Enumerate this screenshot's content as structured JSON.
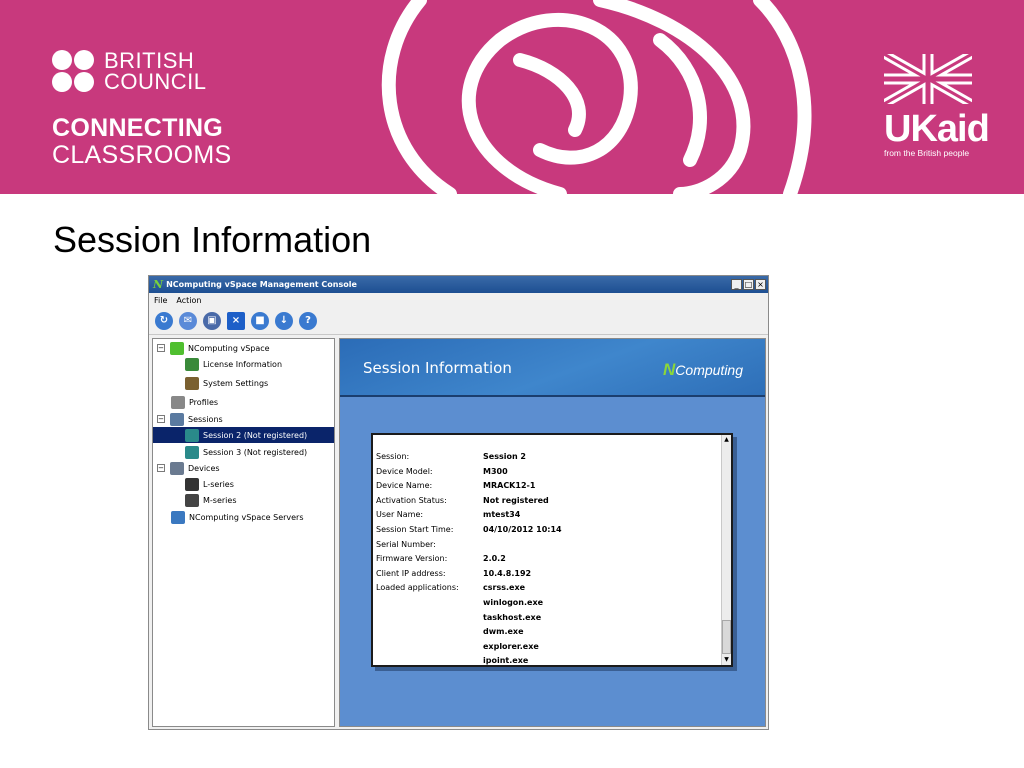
{
  "slide": {
    "brand_line1": "BRITISH",
    "brand_line2": "COUNCIL",
    "program_line1": "CONNECTING",
    "program_line2": "CLASSROOMS",
    "ukaid_word": "UKaid",
    "ukaid_tagline": "from the British people",
    "title": "Session Information",
    "banner_color": "#c8397d"
  },
  "window": {
    "title": "NComputing vSpace Management Console",
    "logo_letter": "N",
    "buttons": {
      "minimize": "_",
      "maximize": "□",
      "close": "×"
    },
    "menu": [
      "File",
      "Action"
    ],
    "toolbar": [
      {
        "icon": "refresh-icon",
        "glyph": "↻",
        "color": "#3a7ad0"
      },
      {
        "icon": "message-icon",
        "glyph": "✉",
        "color": "#5a8ad8"
      },
      {
        "icon": "monitor-icon",
        "glyph": "▣",
        "color": "#4a6aa8"
      },
      {
        "icon": "disconnect-icon",
        "glyph": "×",
        "color": "#1d5fc8"
      },
      {
        "icon": "stop-icon",
        "glyph": "■",
        "color": "#3a7ad0"
      },
      {
        "icon": "download-icon",
        "glyph": "↓",
        "color": "#3a7ad0"
      },
      {
        "icon": "help-icon",
        "glyph": "?",
        "color": "#3a7ad0"
      }
    ]
  },
  "tree": {
    "items": [
      {
        "label": "NComputing vSpace",
        "icon": "ncomputing-logo-icon",
        "expander": "−"
      },
      {
        "label": "License Information",
        "icon": "license-icon"
      },
      {
        "label": "System Settings",
        "icon": "settings-icon"
      },
      {
        "label": "Profiles",
        "icon": "profiles-icon"
      },
      {
        "label": "Sessions",
        "icon": "sessions-icon",
        "expander": "−"
      },
      {
        "label": "Session 2 (Not registered)",
        "icon": "session-monitor-icon",
        "selected": true
      },
      {
        "label": "Session 3 (Not registered)",
        "icon": "session-monitor-icon"
      },
      {
        "label": "Devices",
        "icon": "devices-icon",
        "expander": "−"
      },
      {
        "label": "L-series",
        "icon": "l-series-device-icon"
      },
      {
        "label": "M-series",
        "icon": "m-series-device-icon"
      },
      {
        "label": "NComputing vSpace Servers",
        "icon": "servers-network-icon"
      }
    ]
  },
  "panel": {
    "title": "Session Information",
    "brand_prefix": "N",
    "brand_rest": "Computing",
    "header_color": "#2b6cb7",
    "background_color": "#5c8ed0",
    "rows": [
      {
        "label": "Session:",
        "value": "Session 2"
      },
      {
        "label": "Device Model:",
        "value": "M300"
      },
      {
        "label": "Device Name:",
        "value": "MRACK12-1"
      },
      {
        "label": "Activation Status:",
        "value": "Not registered"
      },
      {
        "label": "User Name:",
        "value": "mtest34"
      },
      {
        "label": "Session Start Time:",
        "value": "04/10/2012 10:14"
      },
      {
        "label": "Serial Number:",
        "value": ""
      },
      {
        "label": "Firmware Version:",
        "value": "2.0.2"
      },
      {
        "label": "Client IP address:",
        "value": "10.4.8.192"
      },
      {
        "label": "Loaded applications:",
        "value": "csrss.exe"
      },
      {
        "label": "",
        "value": "winlogon.exe"
      },
      {
        "label": "",
        "value": "taskhost.exe"
      },
      {
        "label": "",
        "value": "dwm.exe"
      },
      {
        "label": "",
        "value": "explorer.exe"
      },
      {
        "label": "",
        "value": "ipoint.exe"
      }
    ]
  }
}
